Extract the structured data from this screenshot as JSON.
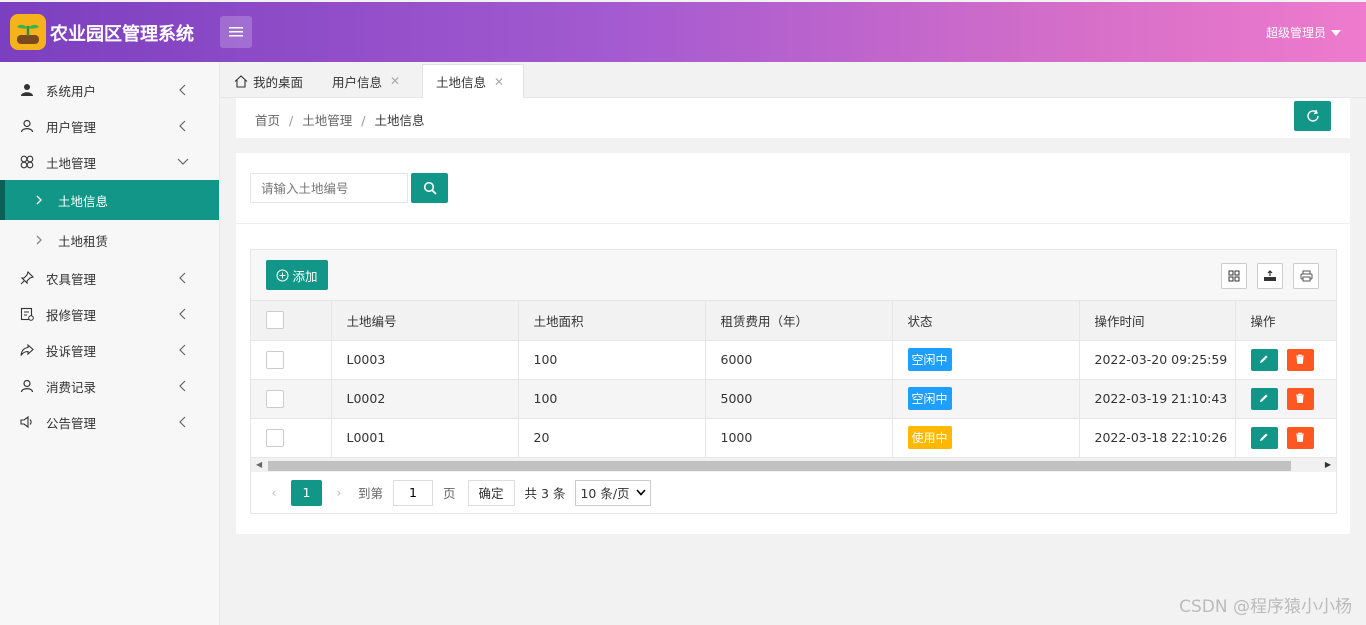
{
  "app": {
    "title": "农业园区管理系统",
    "user": "超级管理员"
  },
  "sidebar": {
    "items": [
      {
        "label": "系统用户"
      },
      {
        "label": "用户管理"
      },
      {
        "label": "土地管理"
      },
      {
        "label": "农具管理"
      },
      {
        "label": "报修管理"
      },
      {
        "label": "投诉管理"
      },
      {
        "label": "消费记录"
      },
      {
        "label": "公告管理"
      }
    ],
    "sub": [
      {
        "label": "土地信息",
        "active": true
      },
      {
        "label": "土地租赁",
        "active": false
      }
    ]
  },
  "tabs": [
    {
      "label": "我的桌面"
    },
    {
      "label": "用户信息"
    },
    {
      "label": "土地信息"
    }
  ],
  "breadcrumb": {
    "home": "首页",
    "parent": "土地管理",
    "current": "土地信息"
  },
  "search": {
    "placeholder": "请输入土地编号"
  },
  "toolbar": {
    "add_label": "添加"
  },
  "table": {
    "headers": [
      "土地编号",
      "土地面积",
      "租赁费用（年）",
      "状态",
      "操作时间",
      "操作"
    ],
    "rows": [
      {
        "code": "L0003",
        "area": "100",
        "fee": "6000",
        "status": "空闲中",
        "time": "2022-03-20 09:25:59"
      },
      {
        "code": "L0002",
        "area": "100",
        "fee": "5000",
        "status": "空闲中",
        "time": "2022-03-19 21:10:43"
      },
      {
        "code": "L0001",
        "area": "20",
        "fee": "1000",
        "status": "使用中",
        "time": "2022-03-18 22:10:26"
      }
    ]
  },
  "pager": {
    "current": "1",
    "goto_label": "到第",
    "input_value": "1",
    "page_unit": "页",
    "ok_label": "确定",
    "total": "共 3 条",
    "page_size": "10 条/页"
  },
  "colors": {
    "accent": "#129687",
    "danger": "#ff5722",
    "idle": "#1e9fff",
    "used": "#ffb800"
  },
  "watermark": "CSDN @程序猿小小杨"
}
